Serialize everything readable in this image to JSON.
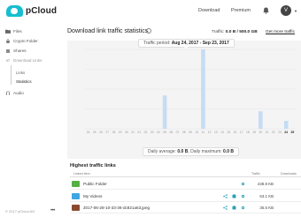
{
  "header": {
    "brand": "pCloud",
    "nav": [
      "Download",
      "Premium"
    ],
    "avatar_letter": "V"
  },
  "sidebar": {
    "items": [
      {
        "label": "Files",
        "icon": "files-icon"
      },
      {
        "label": "Crypto Folder",
        "icon": "lock-icon"
      },
      {
        "label": "Shares",
        "icon": "share-icon"
      },
      {
        "label": "Download Links",
        "icon": "link-icon"
      },
      {
        "label": "Links",
        "icon": "link-item-icon"
      },
      {
        "label": "Statistics",
        "icon": "bar-chart-icon"
      },
      {
        "label": "Audio",
        "icon": "headphones-icon"
      }
    ],
    "footer": "© 2017 pCloud AG",
    "more": "•••"
  },
  "main": {
    "title": "Download link traffic statistics",
    "traffic_label": "Traffic: ",
    "traffic_value": "0.0 B / 500.0 GB",
    "get_more": "Get more traffic",
    "period_label": "Traffic period: ",
    "period_value": "Aug 24, 2017 - Sep 23, 2017",
    "daily_avg_label": "Daily average: ",
    "daily_avg_value": "0.0 B",
    "daily_max_label": ", Daily maximum: ",
    "daily_max_value": "0.0 B"
  },
  "chart_data": {
    "type": "bar",
    "categories": [
      "24",
      "25",
      "26",
      "27",
      "28",
      "29",
      "30",
      "31",
      "01",
      "02",
      "03",
      "04",
      "05",
      "06",
      "07",
      "08",
      "09",
      "10",
      "11",
      "12",
      "13",
      "14",
      "15",
      "16",
      "17",
      "18",
      "19",
      "20",
      "21",
      "22",
      "23",
      "24",
      "25"
    ],
    "values": [
      0,
      0,
      0,
      0,
      0,
      0,
      0,
      0,
      0,
      0,
      0,
      0,
      0.42,
      0,
      0,
      0,
      0,
      0,
      1.0,
      0,
      0,
      0,
      0,
      0,
      0,
      0,
      0,
      0.22,
      0,
      0,
      0,
      0.1,
      0
    ],
    "highlight_last": [
      "24",
      "25"
    ],
    "bar_color": "#c5dcf4",
    "grid": true
  },
  "table": {
    "title": "Highest traffic links",
    "columns": [
      "Linked Item",
      "Traffic",
      "Downloads"
    ],
    "rows": [
      {
        "name": "Public Folder",
        "traffic": "438.8 KB",
        "thumb": "#55b043"
      },
      {
        "name": "My Videos",
        "traffic": "63.1 KB",
        "thumb": "#3ea6e0"
      },
      {
        "name": "2017-06-28-10-33-36-dc821a63.jpeg",
        "traffic": "35.5 KB",
        "thumb": "#8a4a30"
      },
      {
        "name": "Latest Screenshots",
        "traffic": "33.0 KB",
        "thumb": "#3ea6e0"
      }
    ]
  },
  "colors": {
    "accent": "#17bed0",
    "bar": "#c5dcf4"
  }
}
